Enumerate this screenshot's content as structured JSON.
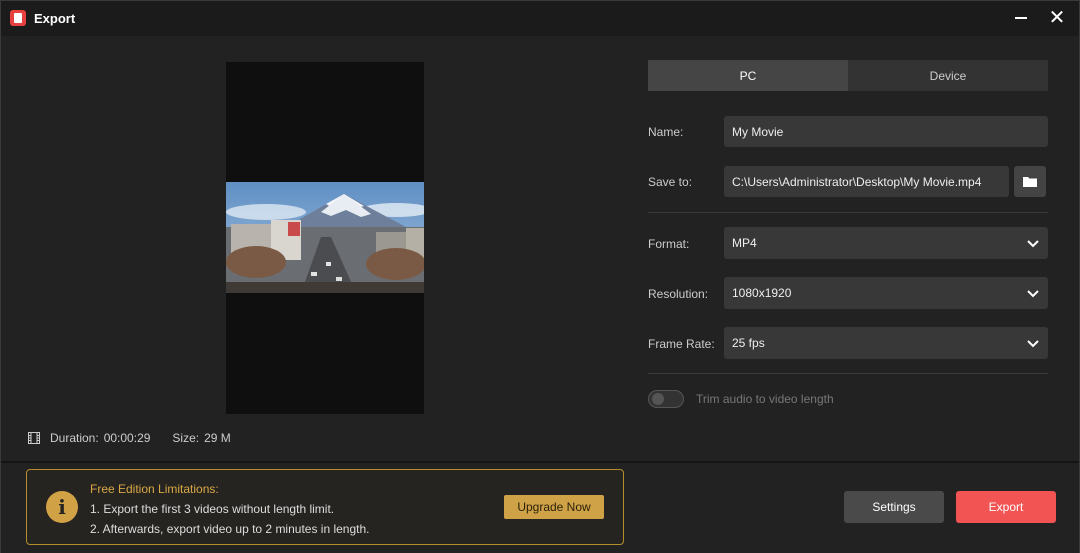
{
  "window": {
    "title": "Export",
    "close_glyph": "✕"
  },
  "preview": {
    "duration_label": "Duration:",
    "duration_value": "00:00:29",
    "size_label": "Size:",
    "size_value": "29 M"
  },
  "tabs": [
    {
      "label": "PC",
      "active": true
    },
    {
      "label": "Device",
      "active": false
    }
  ],
  "form": {
    "name_label": "Name:",
    "name_value": "My Movie",
    "save_label": "Save to:",
    "save_value": "C:\\Users\\Administrator\\Desktop\\My Movie.mp4",
    "format_label": "Format:",
    "format_value": "MP4",
    "resolution_label": "Resolution:",
    "resolution_value": "1080x1920",
    "framerate_label": "Frame Rate:",
    "framerate_value": "25 fps",
    "trim_label": "Trim audio to video length",
    "trim_enabled": false
  },
  "notice": {
    "icon": "i",
    "title": "Free Edition Limitations:",
    "line1": "1. Export the first 3 videos without length limit.",
    "line2": "2. Afterwards, export video up to 2 minutes in length.",
    "upgrade_label": "Upgrade Now"
  },
  "actions": {
    "settings_label": "Settings",
    "export_label": "Export"
  },
  "colors": {
    "accent_export": "#f25353",
    "accent_gold": "#cfa248"
  }
}
